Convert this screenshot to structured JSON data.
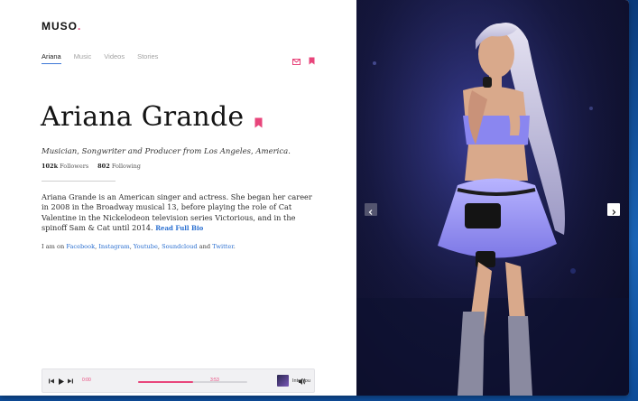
{
  "brand": {
    "logo": "MUSO",
    "logo_dot": "."
  },
  "nav": {
    "items": [
      "Ariana",
      "Music",
      "Videos",
      "Stories"
    ]
  },
  "artist": {
    "name": "Ariana Grande",
    "subtitle": "Musician, Songwriter and Producer from Los Angeles, America.",
    "followers_count": "102k",
    "followers_label": "Followers",
    "following_count": "802",
    "following_label": "Following",
    "bio": "Ariana Grande is an American singer and actress. She began her career in 2008 in the Broadway musical 13, before playing the role of Cat Valentine in the Nickelodeon television series Victorious, and in the spinoff Sam & Cat until 2014.",
    "read_more": "Read Full Bio"
  },
  "socials": {
    "prefix": "I am on",
    "links": [
      "Facebook",
      "Instagram",
      "Youtube",
      "Soundcloud",
      "Twitter"
    ],
    "and": "and",
    "suffix": "."
  },
  "player": {
    "current_time": "0:00",
    "total_time": "3:53",
    "progress": 0.5,
    "track_title": "Into You"
  },
  "colors": {
    "accent": "#e8457b",
    "link": "#2a6fd0",
    "nav_active": "#3d77d6"
  },
  "icons": [
    "mail-icon",
    "bookmark-icon",
    "prev-icon",
    "play-icon",
    "next-icon",
    "volume-icon",
    "chevron-left-icon",
    "chevron-right-icon"
  ]
}
